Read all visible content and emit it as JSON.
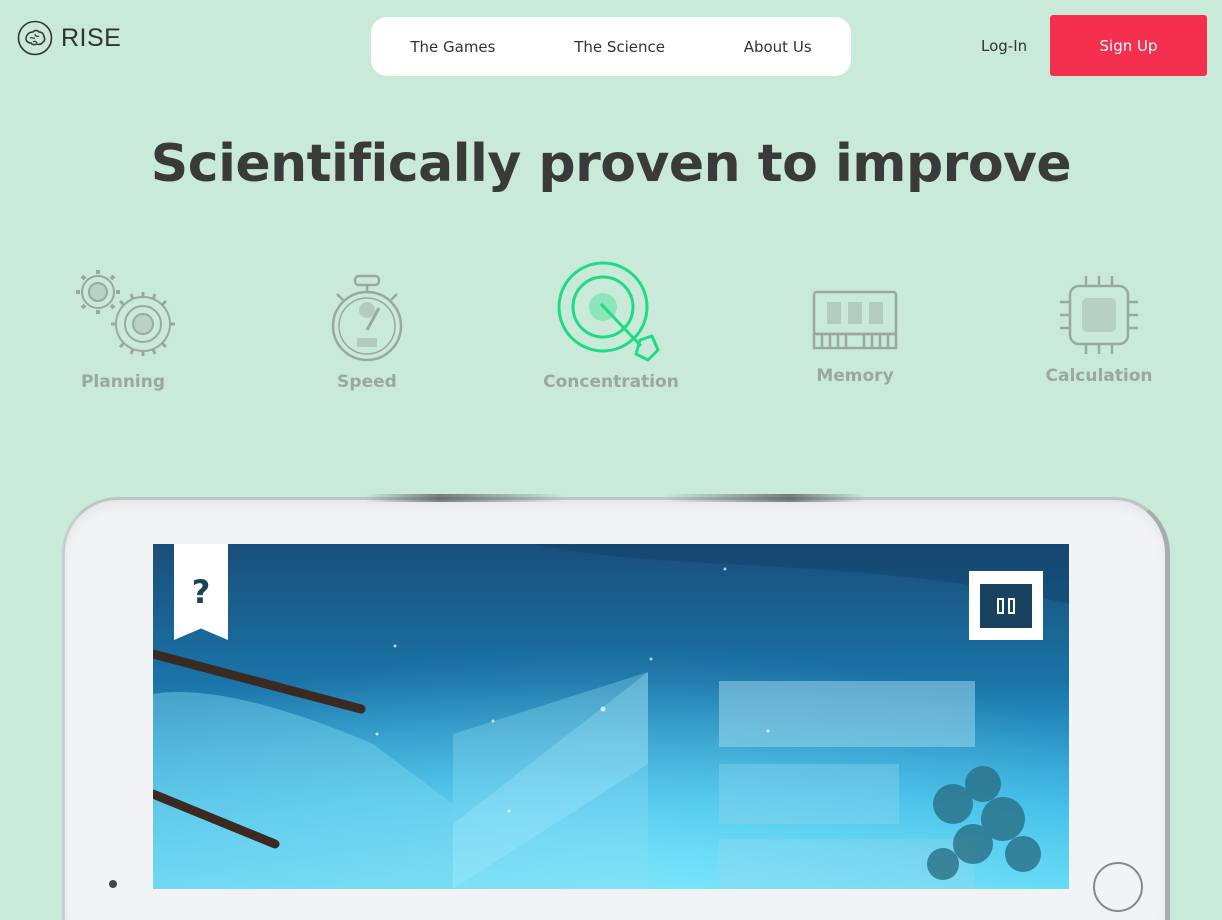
{
  "brand": {
    "name": "RISE",
    "icon": "brain-icon"
  },
  "nav": {
    "items": [
      {
        "label": "The Games"
      },
      {
        "label": "The Science"
      },
      {
        "label": "About Us"
      }
    ],
    "login_label": "Log-In",
    "signup_label": "Sign Up"
  },
  "hero": {
    "headline": "Scientifically proven to improve"
  },
  "skills": [
    {
      "label": "Planning",
      "icon": "gears-icon",
      "active": false
    },
    {
      "label": "Speed",
      "icon": "stopwatch-icon",
      "active": false
    },
    {
      "label": "Concentration",
      "icon": "target-icon",
      "active": true
    },
    {
      "label": "Memory",
      "icon": "memory-chip-icon",
      "active": false
    },
    {
      "label": "Calculation",
      "icon": "cpu-icon",
      "active": false
    }
  ],
  "game": {
    "help_label": "?",
    "pause_icon": "pause-icon"
  },
  "colors": {
    "background": "#c9ead8",
    "accent": "#1ddc84",
    "signup": "#f5304f",
    "inactive_icon": "#9aa9a0"
  }
}
